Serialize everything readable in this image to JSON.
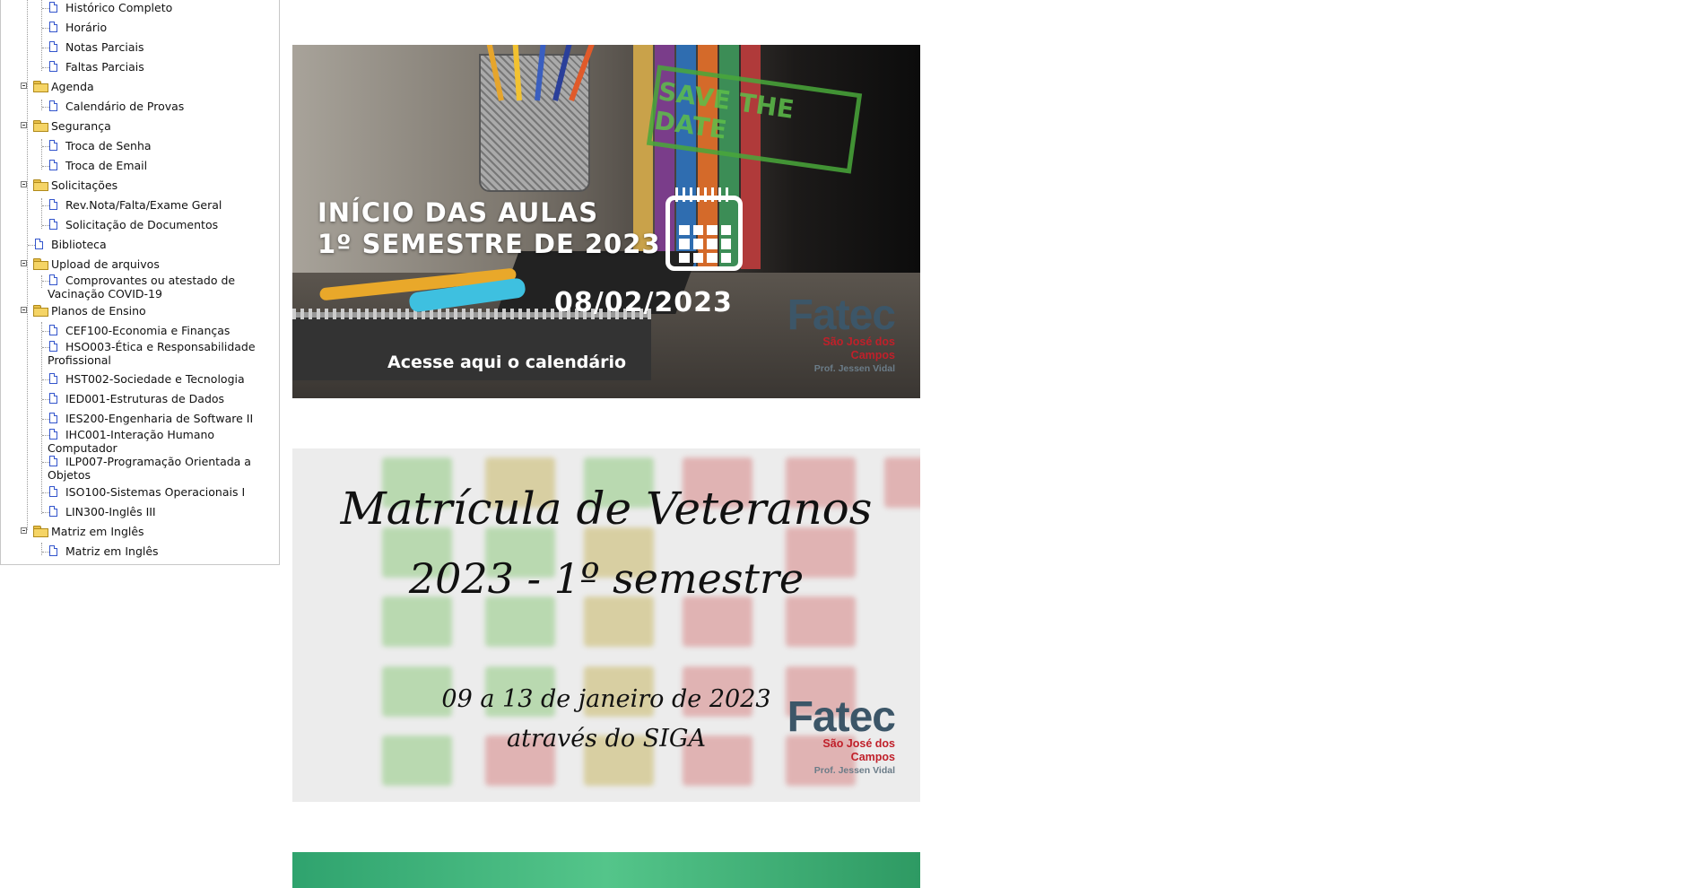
{
  "sidebar": {
    "items": [
      {
        "label": "Histórico Completo"
      },
      {
        "label": "Horário"
      },
      {
        "label": "Notas Parciais"
      },
      {
        "label": "Faltas Parciais"
      },
      {
        "label": "Agenda"
      },
      {
        "label": "Calendário de Provas"
      },
      {
        "label": "Segurança"
      },
      {
        "label": "Troca de Senha"
      },
      {
        "label": "Troca de Email"
      },
      {
        "label": "Solicitações"
      },
      {
        "label": "Rev.Nota/Falta/Exame Geral"
      },
      {
        "label": "Solicitação de Documentos"
      },
      {
        "label": "Biblioteca"
      },
      {
        "label": "Upload de arquivos"
      },
      {
        "line1": "Comprovantes ou atestado de",
        "line2": "Vacinação COVID-19"
      },
      {
        "label": "Planos de Ensino"
      },
      {
        "label": "CEF100-Economia e Finanças"
      },
      {
        "line1": "HSO003-Ética e Responsabilidade",
        "line2": "Profissional"
      },
      {
        "label": "HST002-Sociedade e Tecnologia"
      },
      {
        "label": "IED001-Estruturas de Dados"
      },
      {
        "label": "IES200-Engenharia de Software II"
      },
      {
        "line1": "IHC001-Interação Humano",
        "line2": "Computador"
      },
      {
        "line1": "ILP007-Programação Orientada a",
        "line2": "Objetos"
      },
      {
        "label": "ISO100-Sistemas Operacionais I"
      },
      {
        "label": "LIN300-Inglês III"
      },
      {
        "label": "Matriz em Inglês"
      },
      {
        "label": "Matriz em Inglês"
      }
    ]
  },
  "banner1": {
    "stamp": "SAVE THE DATE",
    "title_line1": "INÍCIO DAS AULAS",
    "title_line2": "1º SEMESTRE DE 2023",
    "date": "08/02/2023",
    "link": "Acesse aqui o calendário",
    "calendar_icon": "calendar-icon"
  },
  "banner2": {
    "title_line1": "Matrícula de Veteranos",
    "title_line2": "2023 - 1º semestre",
    "dates": "09 a 13 de janeiro de 2023",
    "via": "através do SIGA"
  },
  "logo": {
    "name": "Fatec",
    "city_line1": "São José dos",
    "city_line2": "Campos",
    "prof": "Prof. Jessen Vidal"
  },
  "colors": {
    "logo_dark": "#3c5668",
    "logo_red": "#c0202a",
    "stamp_green": "#5dbf4a",
    "doc_icon_blue": "#3355cc",
    "folder_yellow": "#f5d465"
  }
}
